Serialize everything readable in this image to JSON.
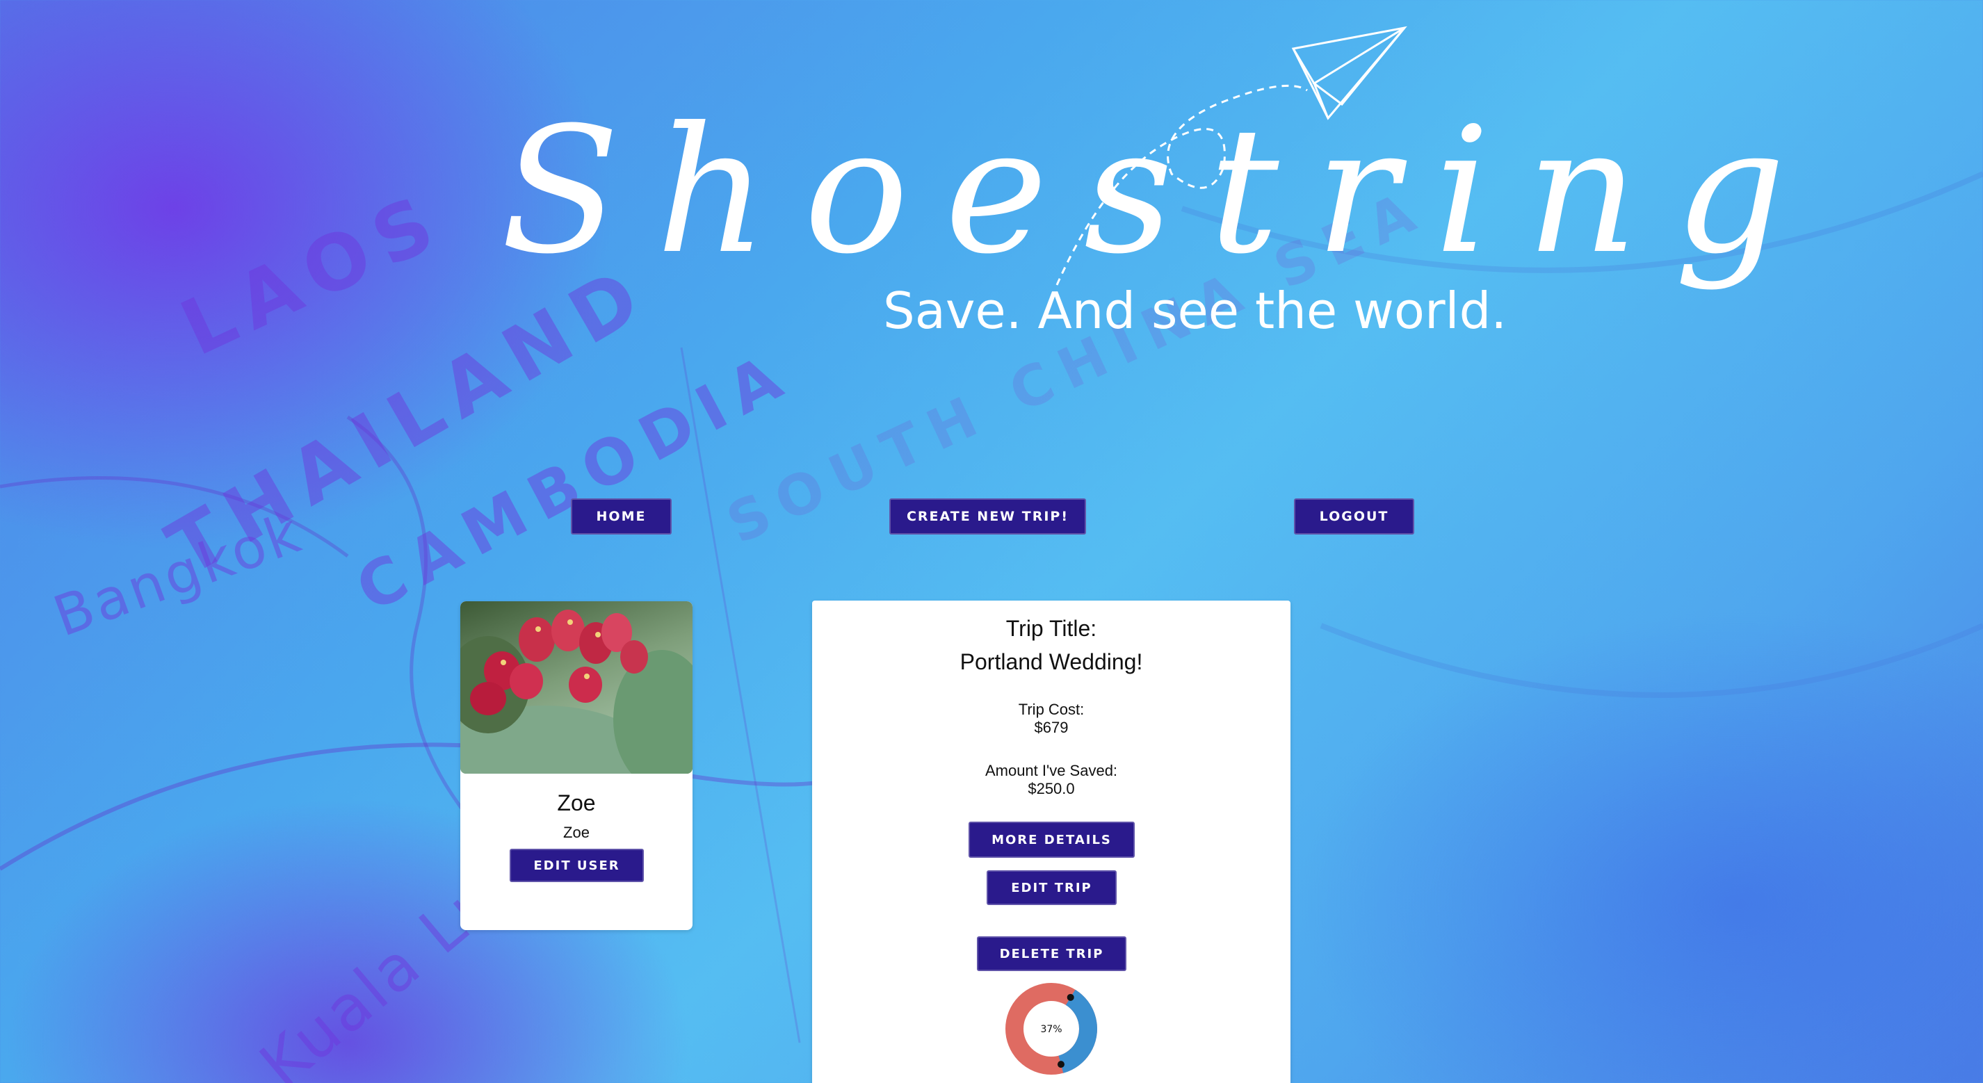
{
  "logo": {
    "title": "Shoestring",
    "tagline": "Save. And see the world."
  },
  "nav": {
    "home_label": "HOME",
    "create_label": "CREATE NEW TRIP!",
    "logout_label": "LOGOUT"
  },
  "user": {
    "name": "Zoe",
    "username": "Zoe",
    "edit_label": "EDIT USER"
  },
  "trip": {
    "title_label": "Trip Title:",
    "title_value": "Portland Wedding!",
    "cost_label": "Trip Cost:",
    "cost_value": "$679",
    "saved_label": "Amount I've Saved:",
    "saved_value": "$250.0",
    "more_details_label": "MORE DETAILS",
    "edit_trip_label": "EDIT TRIP",
    "delete_trip_label": "DELETE TRIP",
    "progress_text": "37%",
    "progress_fraction": 0.37
  },
  "colors": {
    "button_bg": "#2a1a8c",
    "donut_saved": "#3b8fd0",
    "donut_remaining": "#df6b62"
  },
  "background_map_labels": [
    "LAOS",
    "THAILAND",
    "CAMBODIA",
    "Bangkok",
    "SOUTH CHINA SEA",
    "Kuala Lu"
  ]
}
